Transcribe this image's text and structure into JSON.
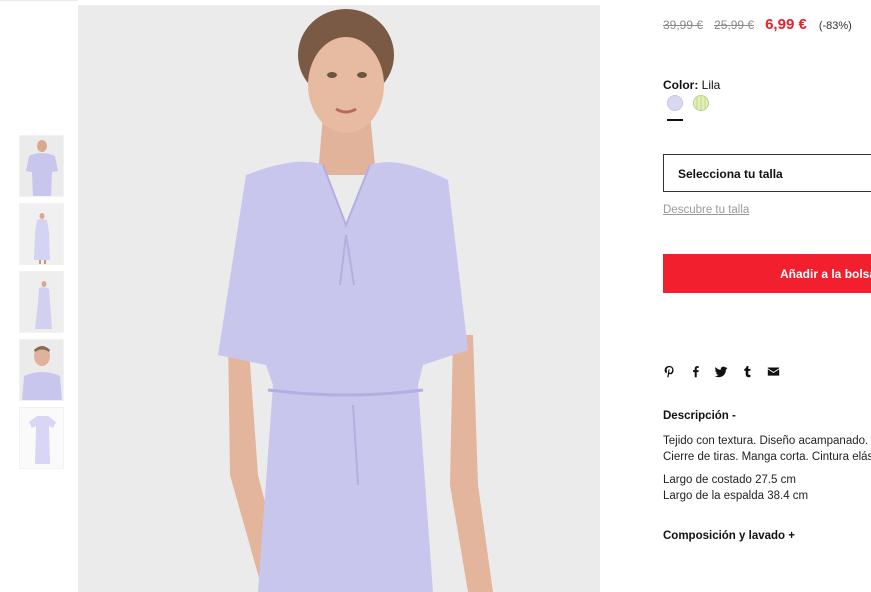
{
  "thumbnails": [
    {
      "alt": "thumb-1"
    },
    {
      "alt": "thumb-2"
    },
    {
      "alt": "thumb-3"
    },
    {
      "alt": "thumb-4"
    },
    {
      "alt": "thumb-5"
    }
  ],
  "product": {
    "price_original": "39,99 €",
    "price_previous": "25,99 €",
    "price_current": "6,99 €",
    "discount": "(-83%)",
    "color_label": "Color:",
    "color_value": "Lila",
    "swatches": [
      {
        "name": "Lila",
        "color": "#d9d8f2"
      },
      {
        "name": "Lima",
        "color": "#d2e59d"
      }
    ],
    "size_select_label": "Selecciona tu talla",
    "size_guide_link": "Descubre tu talla",
    "add_to_bag_label": "Añadir a la bolsa",
    "share_icons": [
      "pinterest-icon",
      "facebook-icon",
      "twitter-icon",
      "tumblr-icon",
      "email-icon"
    ],
    "description_title": "Descripción -",
    "description_lines": [
      "Tejido con textura. Diseño acampanado.",
      "Cierre de tiras. Manga corta. Cintura elástica."
    ],
    "measure_lines": [
      "Largo de costado 27.5 cm",
      "Largo de la espalda 38.4 cm"
    ],
    "composition_title": "Composición y lavado +"
  },
  "colors": {
    "sale_red": "#e5202b",
    "button_red": "#f2202f",
    "dress_lilac": "#c9c6ee",
    "image_bg": "#ebebeb"
  }
}
